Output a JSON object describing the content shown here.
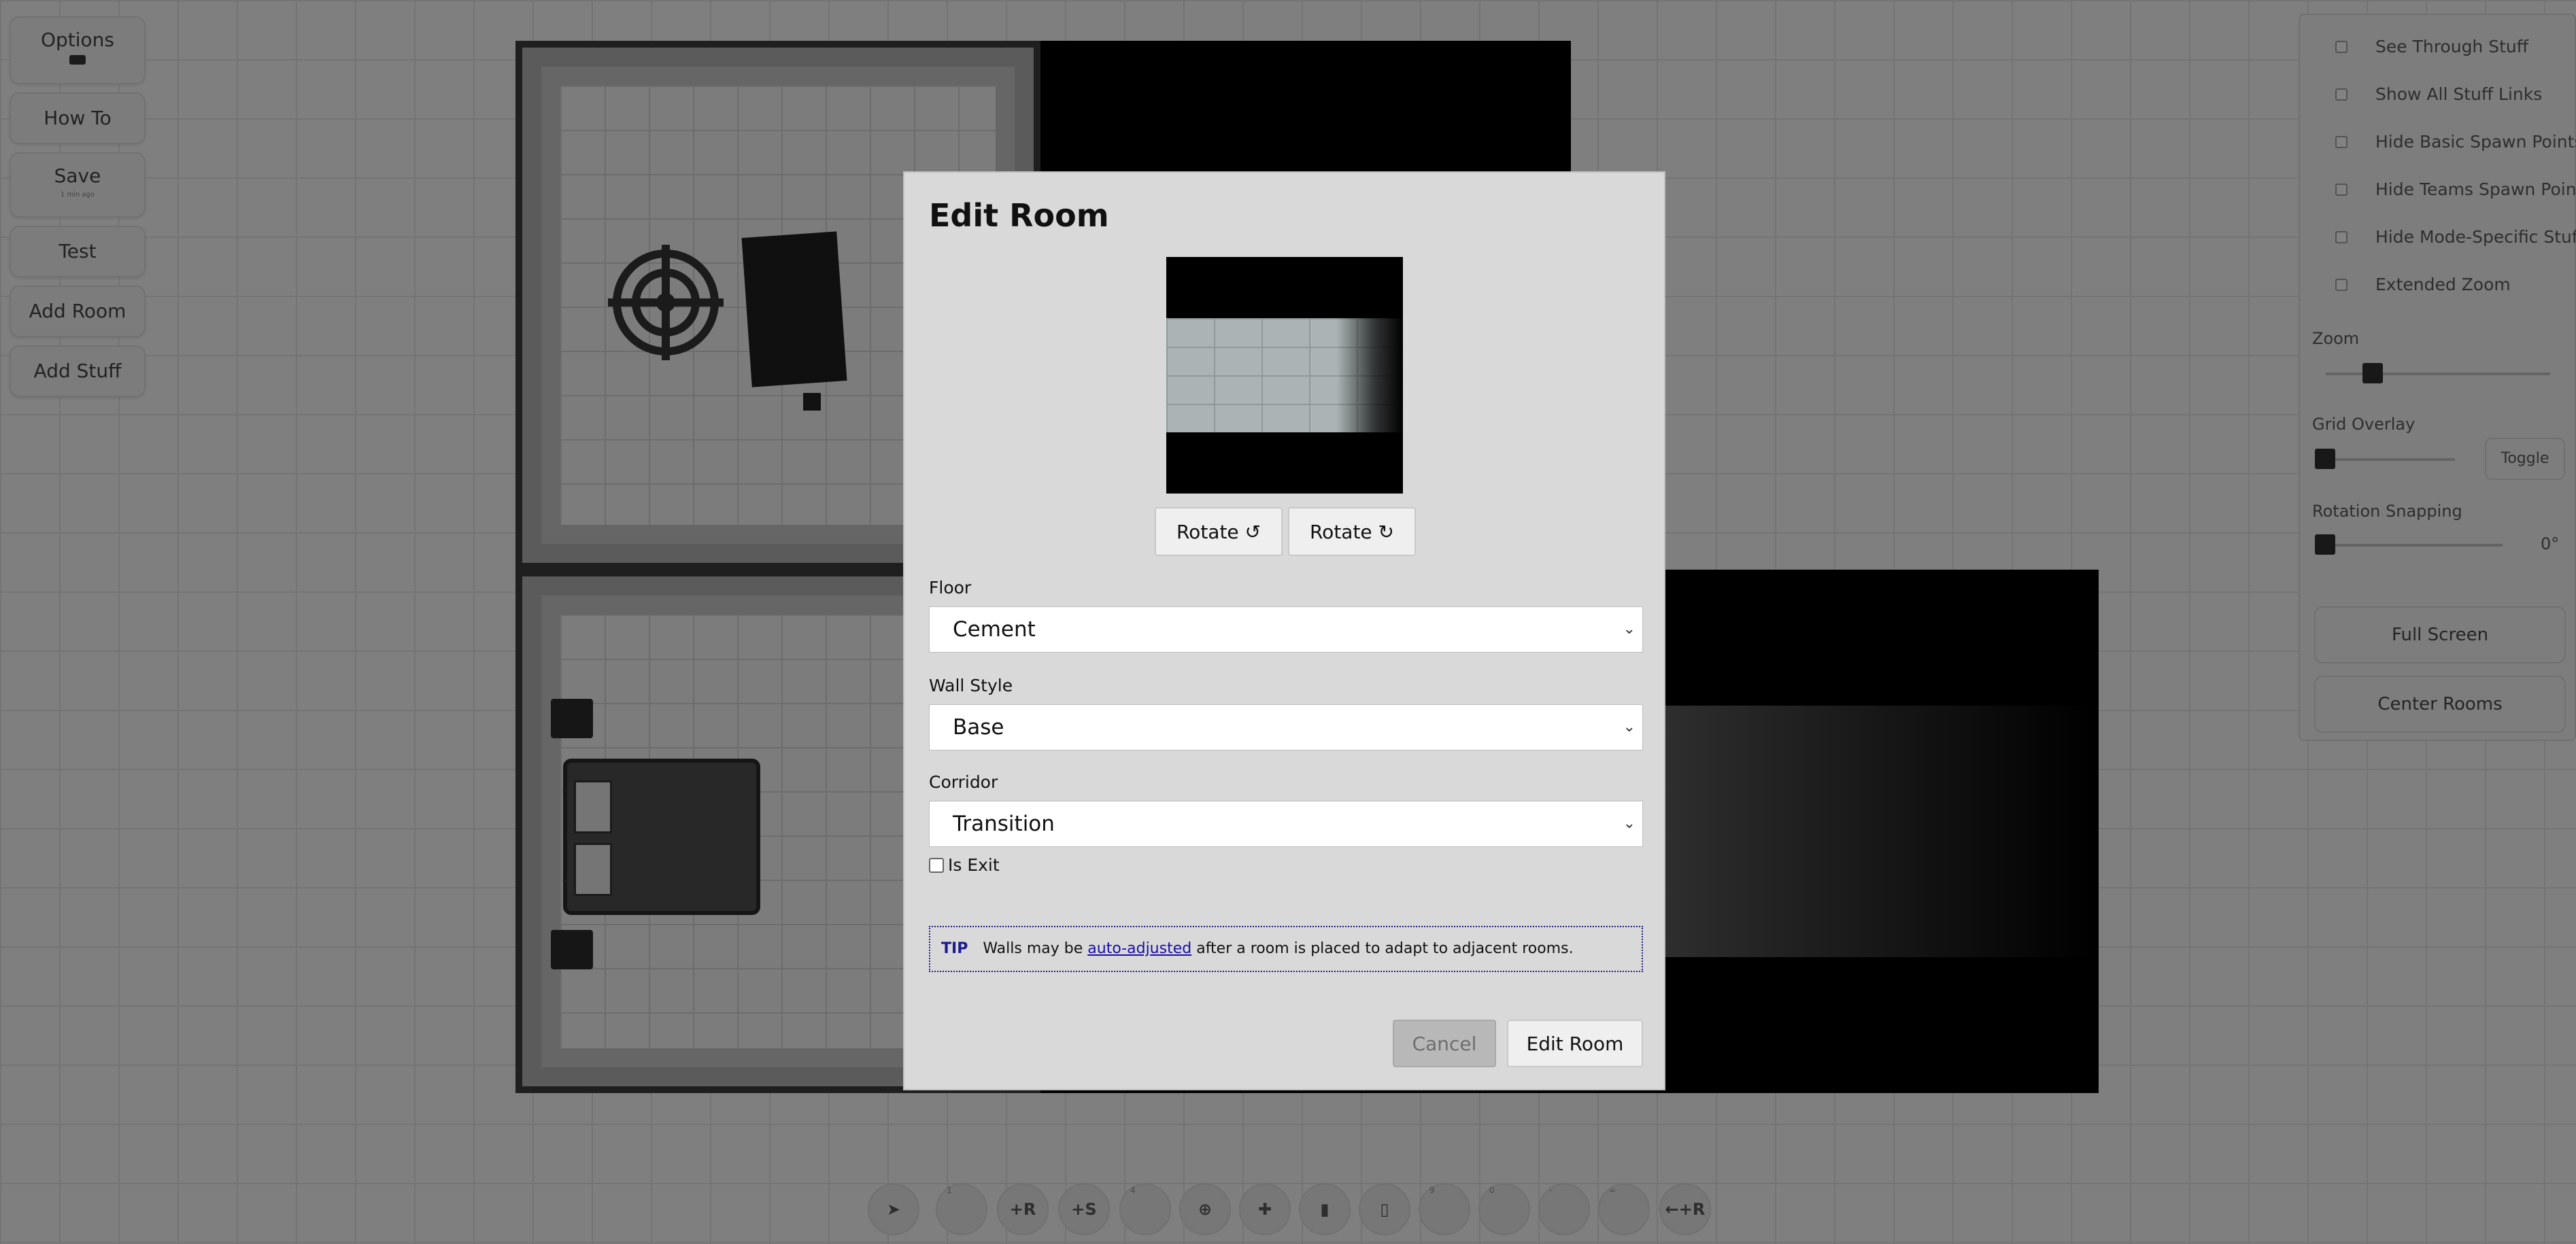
{
  "left_menu": {
    "options": {
      "label": "Options",
      "icon": "keyboard-icon"
    },
    "how_to": "How To",
    "save": {
      "label": "Save",
      "sub": "1 min ago"
    },
    "test": "Test",
    "add_room": "Add Room",
    "add_stuff": "Add Stuff"
  },
  "right_panel": {
    "toggles": [
      "See Through Stuff",
      "Show All Stuff Links",
      "Hide Basic Spawn Points",
      "Hide Teams Spawn Points",
      "Hide Mode-Specific Stuff",
      "Extended Zoom"
    ],
    "zoom_label": "Zoom",
    "grid_overlay_label": "Grid Overlay",
    "grid_toggle": "Toggle",
    "rotation_snapping_label": "Rotation Snapping",
    "rotation_value": "0°",
    "full_screen": "Full Screen",
    "center_rooms": "Center Rooms"
  },
  "toolbar": {
    "items": [
      {
        "text": "",
        "num": "",
        "icon": "cursor-icon"
      },
      {
        "text": "",
        "num": "1",
        "icon": "empty-slot-icon"
      },
      {
        "text": "+R",
        "num": "",
        "icon": "add-room-icon"
      },
      {
        "text": "+S",
        "num": "",
        "icon": "add-stuff-icon"
      },
      {
        "text": "",
        "num": "4",
        "icon": "empty-slot-icon"
      },
      {
        "text": "",
        "num": "",
        "icon": "target-icon"
      },
      {
        "text": "",
        "num": "",
        "icon": "medkit-icon"
      },
      {
        "text": "",
        "num": "",
        "icon": "door-icon"
      },
      {
        "text": "",
        "num": "",
        "icon": "phone-icon"
      },
      {
        "text": "",
        "num": "9",
        "icon": "empty-slot-icon"
      },
      {
        "text": "",
        "num": "0",
        "icon": "empty-slot-icon"
      },
      {
        "text": "",
        "num": "-",
        "icon": "empty-slot-icon"
      },
      {
        "text": "",
        "num": "=",
        "icon": "empty-slot-icon"
      },
      {
        "text": "←+R",
        "num": "",
        "icon": "back-add-room-icon"
      }
    ]
  },
  "modal": {
    "title": "Edit Room",
    "rotate_ccw": "Rotate ↺",
    "rotate_cw": "Rotate ↻",
    "floor_label": "Floor",
    "floor_value": "Cement",
    "wall_style_label": "Wall Style",
    "wall_style_value": "Base",
    "corridor_label": "Corridor",
    "corridor_value": "Transition",
    "is_exit_label": "Is Exit",
    "is_exit_checked": false,
    "tip_tag": "TIP",
    "tip_before": "Walls may be ",
    "tip_link": "auto-adjusted",
    "tip_after": " after a room is placed to adapt to adjacent rooms.",
    "cancel": "Cancel",
    "submit": "Edit Room"
  }
}
